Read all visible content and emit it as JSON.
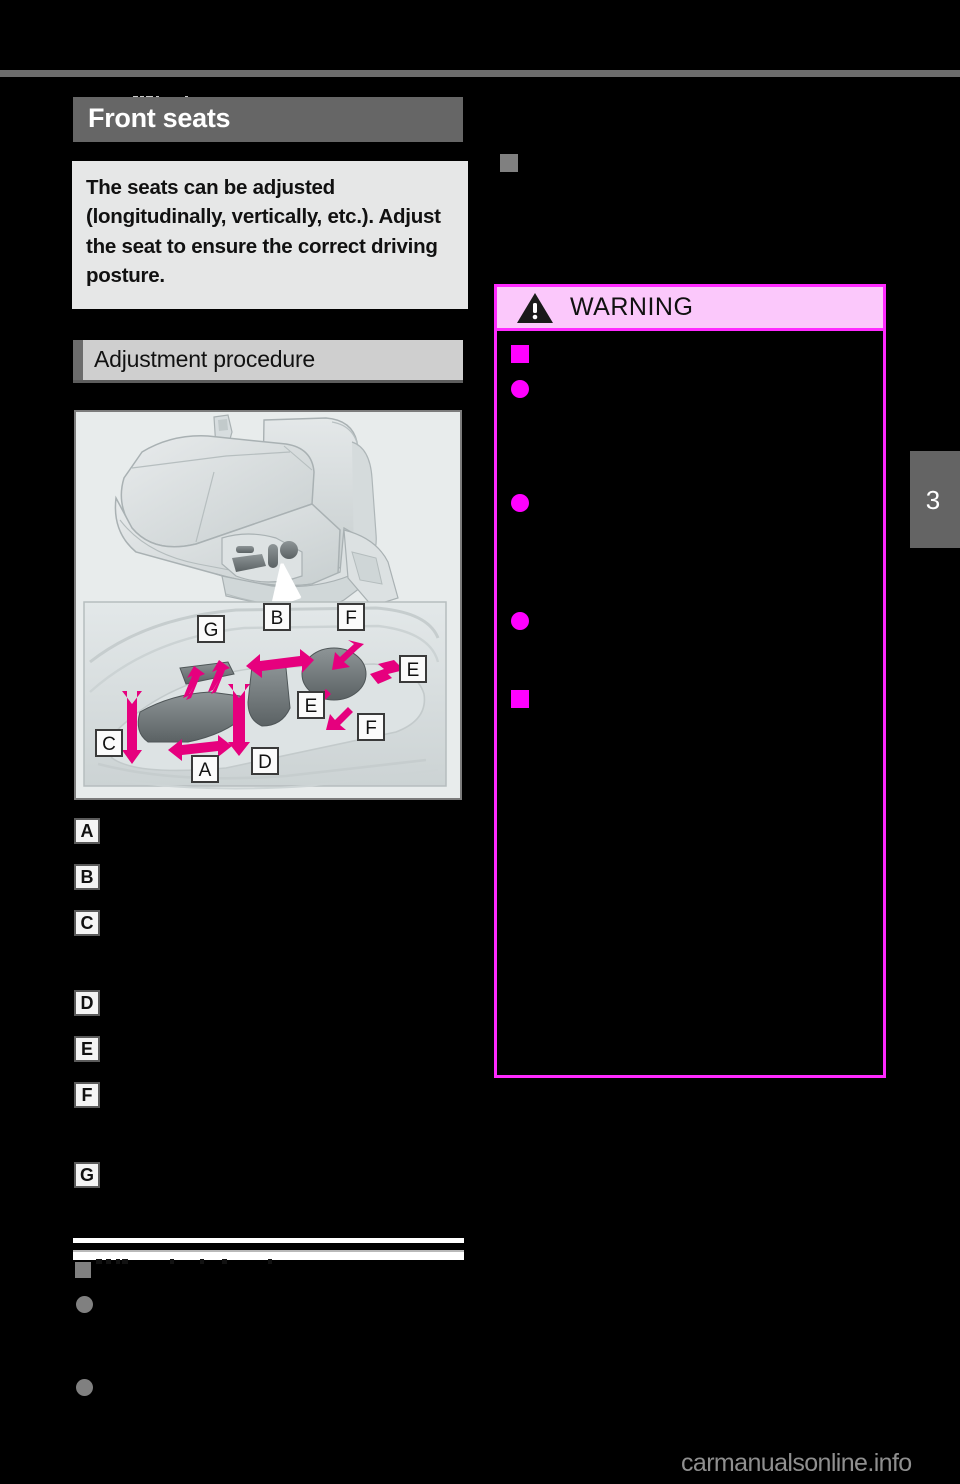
{
  "document": {
    "type": "car-owners-manual-page",
    "page_number": "3",
    "watermark": "carmanualsonline.info"
  },
  "left_column": {
    "section_title": "Front seats",
    "intro_text": "The seats can be adjusted (longitudinally, vertically, etc.). Adjust the seat to ensure the correct driving posture.",
    "sub_section_title": "Adjustment procedure",
    "illustration": {
      "caption_labels": [
        "A",
        "B",
        "C",
        "D",
        "E",
        "F",
        "G"
      ],
      "panel_labels": [
        "G",
        "B",
        "F",
        "E",
        "E",
        "F",
        "C",
        "A",
        "D"
      ],
      "description": "Front seat with power seat control switches; callout arrows A through G"
    },
    "callouts": [
      {
        "letter": "A",
        "text": ""
      },
      {
        "letter": "B",
        "text": ""
      },
      {
        "letter": "C",
        "text": ""
      },
      {
        "letter": "D",
        "text": ""
      },
      {
        "letter": "E",
        "text": ""
      },
      {
        "letter": "F",
        "text": ""
      },
      {
        "letter": "G",
        "text": ""
      }
    ],
    "notes": {
      "heading": "",
      "bullets": [
        "",
        ""
      ]
    }
  },
  "right_column": {
    "note_marker": "square-marker",
    "warning": {
      "label": "WARNING",
      "icon": "warning-triangle-icon",
      "items": [
        {
          "marker": "square",
          "text": ""
        },
        {
          "marker": "dot",
          "text": ""
        },
        {
          "marker": "dot",
          "text": ""
        },
        {
          "marker": "dot",
          "text": ""
        },
        {
          "marker": "square",
          "text": ""
        }
      ]
    }
  },
  "colors": {
    "page_background": "#000000",
    "header_bar": "#666666",
    "intro_panel": "#e6e7e7",
    "sub_header": "#cfcfcf",
    "warning_border": "#ff2aff",
    "warning_header_fill": "#fbc8fb",
    "warning_marker": "#ff00ff",
    "illustration_background": "#e8ecec",
    "arrow_magenta": "#e6007e",
    "page_tab": "#646464",
    "watermark": "#8f8f8f"
  }
}
